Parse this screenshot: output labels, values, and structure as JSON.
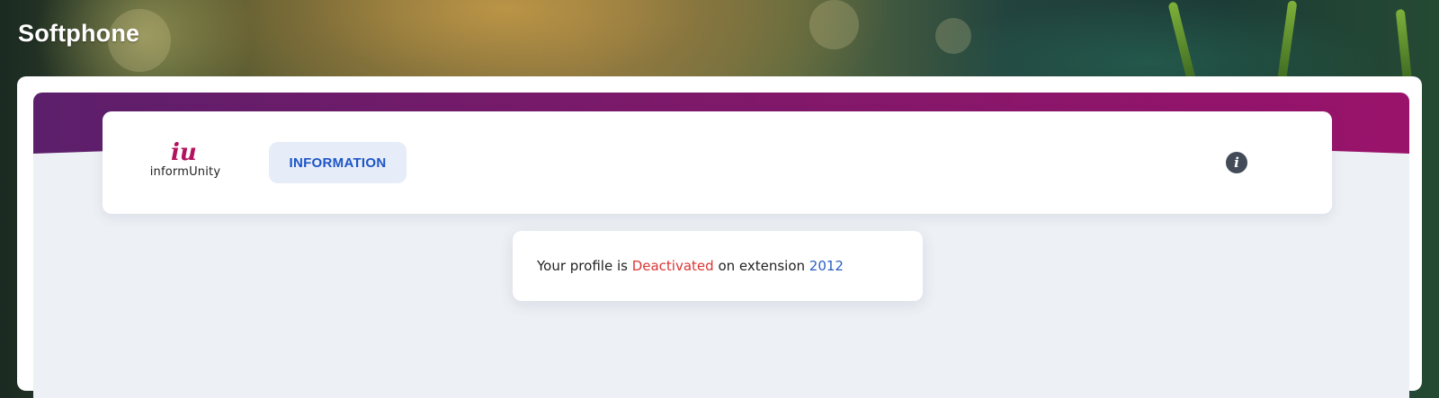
{
  "app": {
    "title": "Softphone"
  },
  "header": {
    "logo": {
      "mark": "iu",
      "name": "informUnity"
    },
    "tabs": [
      {
        "label": "INFORMATION",
        "active": true
      }
    ],
    "info_icon": "info-circle-icon"
  },
  "status": {
    "prefix": "Your profile is ",
    "state": "Deactivated",
    "middle": " on extension ",
    "extension": "2012"
  },
  "colors": {
    "brand_gradient_start": "#5c1f6b",
    "brand_gradient_end": "#9a136b",
    "tab_text": "#1c55c7",
    "tab_bg": "#e6ecf8",
    "deactivated": "#dc3535",
    "extension": "#2a5fc4",
    "logo": "#b3125f"
  }
}
